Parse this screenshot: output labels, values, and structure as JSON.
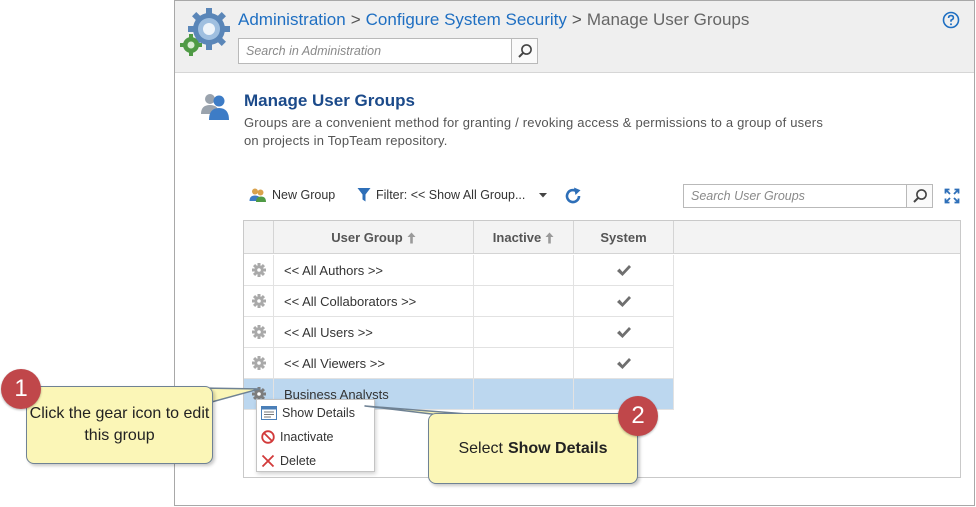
{
  "breadcrumb": {
    "items": [
      "Administration",
      "Configure System Security"
    ],
    "separator": ">",
    "current": "Manage User Groups"
  },
  "admin_search": {
    "placeholder": "Search in Administration"
  },
  "page": {
    "title": "Manage User Groups",
    "description": "Groups are a convenient method for granting / revoking access & permissions to a group of users on projects in TopTeam repository."
  },
  "toolbar": {
    "new_group_label": "New Group",
    "filter_label": "Filter: << Show All Group...",
    "search_placeholder": "Search User Groups"
  },
  "grid": {
    "columns": [
      "User Group",
      "Inactive",
      "System"
    ],
    "rows": [
      {
        "name": "<< All Authors >>",
        "inactive": false,
        "system": true
      },
      {
        "name": "<< All Collaborators >>",
        "inactive": false,
        "system": true
      },
      {
        "name": "<< All Users >>",
        "inactive": false,
        "system": true
      },
      {
        "name": "<< All Viewers >>",
        "inactive": false,
        "system": true
      },
      {
        "name": "Business Analysts",
        "inactive": false,
        "system": false,
        "selected": true
      }
    ]
  },
  "context_menu": {
    "items": [
      "Show Details",
      "Inactivate",
      "Delete"
    ]
  },
  "callouts": {
    "step1": {
      "number": "1",
      "text": "Click the gear icon to edit this group"
    },
    "step2": {
      "number": "2",
      "prefix": "Select",
      "bold": "Show Details"
    }
  },
  "colors": {
    "link": "#1f6fc2",
    "title": "#1b4a8a",
    "selected_row": "#bcd7ef",
    "callout_fill": "#fbf6b7",
    "badge": "#c0474a"
  },
  "icons": [
    "admin-gears-icon",
    "help-icon",
    "search-icon",
    "user-group-icon",
    "new-group-icon",
    "filter-icon",
    "dropdown-arrow-icon",
    "refresh-icon",
    "expand-icon",
    "row-gear-icon",
    "checkmark-icon",
    "sort-arrow-icon",
    "details-icon",
    "inactivate-icon",
    "delete-icon"
  ]
}
